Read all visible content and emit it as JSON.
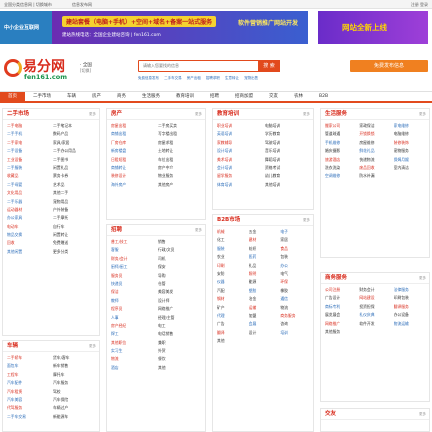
{
  "topbar": {
    "left": "全国分类信息网 | 切换城市",
    "left2": "信息发布网",
    "right": "注册 登录"
  },
  "banners": {
    "b1": "中小企业互联网",
    "b2_title": "建站套餐（电脑+手机）+空间+域名+备案一站式服务",
    "b2_sub": "建站热线电话：全国企业建站咨询 | fen161.com",
    "b2_side": "软件营销推广网站开发",
    "b3": "网站全新上线"
  },
  "logo": {
    "name": "易分网",
    "domain": "fen161.com"
  },
  "city": {
    "name": "· 全国",
    "switch": "[切换]"
  },
  "search": {
    "placeholder": "请输入您要找的信息",
    "button": "搜 索"
  },
  "hot": [
    "免费信息发布",
    "二手车交易",
    "房产出租",
    "招聘求职",
    "生意转让",
    "宠物出售"
  ],
  "publish": "免费发布信息",
  "nav": [
    "首页",
    "二手市场",
    "车辆",
    "房产",
    "商务",
    "生活服务",
    "教育培训",
    "招聘",
    "招商加盟",
    "交友",
    "农林",
    "B2B"
  ],
  "sections": {
    "ershou": {
      "title": "二手市场",
      "more": "更多",
      "items": [
        "二手电脑",
        "二手笔记本",
        "二手手机",
        "数码产品",
        "二手家电",
        "家具/家居",
        "二手设备",
        "二手办公用品",
        "工业设备",
        "二手图书",
        "二手服装",
        "闲置礼品",
        "收藏品",
        "票务卡券",
        "二手母婴",
        "艺术品",
        "文化用品",
        "其他二手",
        "二手乐器",
        "宠物用品",
        "运动器材",
        "户外装备",
        "办公家具",
        "二手摩托",
        "电动车",
        "自行车",
        "物品交换",
        "闲置转让",
        "回收",
        "免费赠送",
        "其他闲置",
        "更多分类"
      ]
    },
    "car": {
      "title": "车辆",
      "more": "更多",
      "items": [
        "二手轿车",
        "货车/客车",
        "面包车",
        "新车销售",
        "工程车",
        "摩托车",
        "汽车配件",
        "汽车服务",
        "汽车租赁",
        "驾校",
        "汽车美容",
        "汽车保险",
        "代驾服务",
        "车辆过户",
        "二手车交易",
        "新能源车"
      ]
    },
    "house": {
      "title": "房产",
      "more": "更多",
      "items": [
        "房屋出租",
        "二手房买卖",
        "商铺出租",
        "写字楼出租",
        "厂房仓库",
        "房屋求租",
        "新房楼盘",
        "土地转让",
        "日租短租",
        "车位出租",
        "商铺转让",
        "房产中介",
        "装修设计",
        "物业服务",
        "海外房产",
        "其他房产"
      ]
    },
    "jiaoyu": {
      "title": "教育培训",
      "more": "更多",
      "items": [
        "职业培训",
        "电脑培训",
        "英语培训",
        "学历教育",
        "家教辅导",
        "驾驶培训",
        "设计培训",
        "音乐培训",
        "美术培训",
        "舞蹈培训",
        "会计培训",
        "资格考试",
        "留学服务",
        "幼儿教育",
        "体育培训",
        "其他培训"
      ]
    },
    "zhaopin": {
      "title": "招聘",
      "more": "更多",
      "items": [
        "普工/技工",
        "销售",
        "客服",
        "行政/文员",
        "财务/会计",
        "司机",
        "厨师/厨工",
        "保安",
        "服务员",
        "导购",
        "快递员",
        "仓管",
        "保洁",
        "美容美发",
        "教师",
        "设计师",
        "程序员",
        "网络推广",
        "人事",
        "经理/主管",
        "房产经纪",
        "电工",
        "焊工",
        "电话销售",
        "其他职位",
        "兼职",
        "实习生",
        "外贸",
        "物流",
        "餐饮",
        "酒店",
        "其他"
      ]
    },
    "b2b": {
      "title": "B2B市场",
      "more": "更多",
      "items": [
        "机械",
        "五金",
        "电子",
        "化工",
        "建材",
        "家居",
        "服装",
        "纺织",
        "食品",
        "农业",
        "医药",
        "包装",
        "印刷",
        "礼品",
        "办公",
        "安防",
        "照明",
        "电气",
        "仪器",
        "能源",
        "环保",
        "汽配",
        "塑胶",
        "橡胶",
        "钢材",
        "冶金",
        "通信",
        "矿产",
        "运输",
        "物流",
        "代理",
        "加盟",
        "商务服务",
        "广告",
        "会展",
        "咨询",
        "翻译",
        "设计",
        "培训",
        "其他"
      ]
    },
    "life": {
      "title": "生活服务",
      "more": "更多",
      "items": [
        "搬家公司",
        "家政保洁",
        "家电维修",
        "管道疏通",
        "开锁换锁",
        "电脑维修",
        "手机维修",
        "房屋维修",
        "装修装饰",
        "婚庆摄影",
        "鲜花礼品",
        "宠物服务",
        "旅游酒店",
        "快递物流",
        "保姆月嫂",
        "洗衣洗染",
        "废品回收",
        "室内清洁",
        "空调维修",
        "防水补漏"
      ]
    },
    "shangwu": {
      "title": "商务服务",
      "more": "更多",
      "items": [
        "公司注册",
        "财务会计",
        "法律服务",
        "广告设计",
        "网站建设",
        "印刷包装",
        "商标专利",
        "投资担保",
        "翻译服务",
        "展览展会",
        "礼仪庆典",
        "办公设备",
        "网络推广",
        "软件开发",
        "物流运输",
        "其他服务"
      ]
    },
    "jiaoyou": {
      "title": "交友",
      "more": "更多",
      "items": []
    }
  }
}
